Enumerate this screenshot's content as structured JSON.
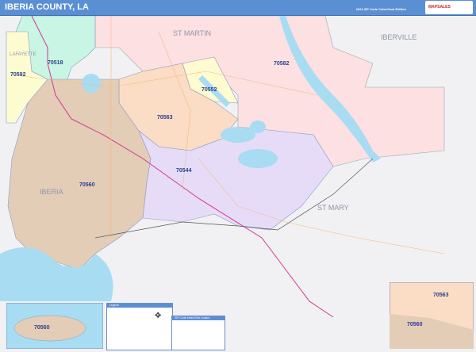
{
  "header": {
    "title": "IBERIA COUNTY, LA",
    "subtitle": "2024 ZIP Code Color/Cast Edition",
    "logo_text": "MAPSALES"
  },
  "map": {
    "county_labels": [
      "ST MARTIN",
      "IBERVILLE",
      "LAFAYETTE",
      "IBERIA",
      "ST MARY"
    ],
    "zip_labels": [
      "70518",
      "70592",
      "70582",
      "70552",
      "70563",
      "70544",
      "70560"
    ],
    "colors": {
      "water": "#a8dcf2",
      "zip_70560": "#e3cdb7",
      "zip_70544": "#e6dcf7",
      "zip_70563": "#fbdcc4",
      "zip_70552": "#fdfbcf",
      "zip_70582": "#fde0e2",
      "zip_70518": "#c8f5e4",
      "zip_70592": "#fdfbd0",
      "outside": "#f1f1f3",
      "interstate": "#d6338f"
    }
  },
  "inset_left": {
    "zip": "70560"
  },
  "inset_right": {
    "zips": [
      "70563",
      "70560"
    ]
  },
  "legend": {
    "title": "Legend"
  },
  "zip_index": {
    "title": "ZIP Code Index/Grid Locator"
  }
}
